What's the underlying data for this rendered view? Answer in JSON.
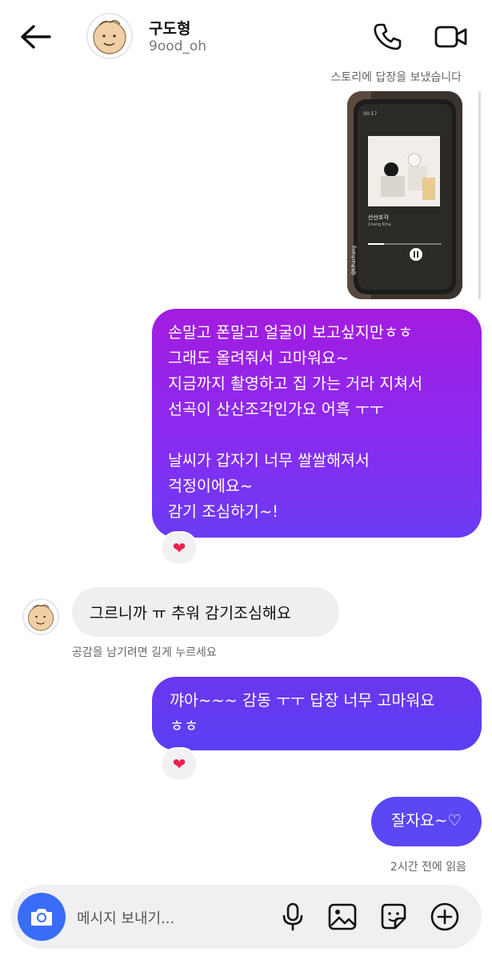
{
  "header": {
    "title": "구도형",
    "username": "9ood_oh"
  },
  "story_note": "스토리에 답장을 보냈습니다",
  "messages": {
    "out1": "손말고 폰말고 얼굴이 보고싶지만ㅎㅎ\n그래도 올려줘서 고마워요~\n지금까지 촬영하고 집 가는 거라 지쳐서\n선곡이 산산조각인가요 어흑 ㅜㅜ\n\n날씨가 갑자기 너무 쌀쌀해져서\n걱정이에요~\n감기 조심하기~!",
    "in1": "그르니까 ㅠ 추워 감기조심해요",
    "hint": "공감을 남기려면 길게 누르세요",
    "out2": "꺄아~~~ 감동 ㅜㅜ 답장 너무 고마워요\nㅎㅎ",
    "out3": "잘자요~♡",
    "seen": "2시간 전에 읽음",
    "reaction": "❤"
  },
  "story_image": {
    "song": "산산조각",
    "artist": "Chang Kiha",
    "watermark": "@kihachang",
    "time": "00:17"
  },
  "composer": {
    "placeholder": "메시지 보내기..."
  },
  "colors": {
    "bubble_purple": "#a31cdf",
    "bubble_indigo": "#5b47f3",
    "camera_blue": "#3a6df7",
    "heart": "#e8234b"
  }
}
